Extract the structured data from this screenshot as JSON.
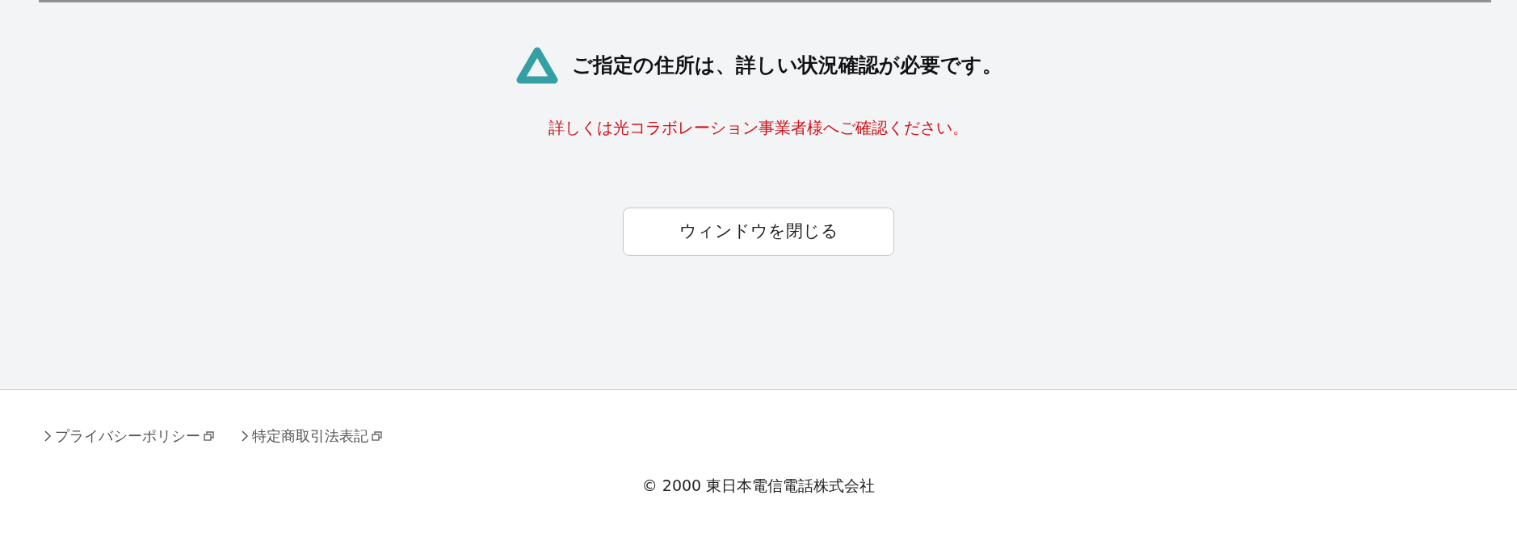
{
  "notice": {
    "title": "ご指定の住所は、詳しい状況確認が必要です。",
    "message": "詳しくは光コラボレーション事業者様へご確認ください。"
  },
  "button": {
    "label": "ウィンドウを閉じる"
  },
  "footer": {
    "links": [
      {
        "label": "プライバシーポリシー"
      },
      {
        "label": "特定商取引法表記"
      }
    ],
    "copyright": "© 2000 東日本電信電話株式会社"
  }
}
